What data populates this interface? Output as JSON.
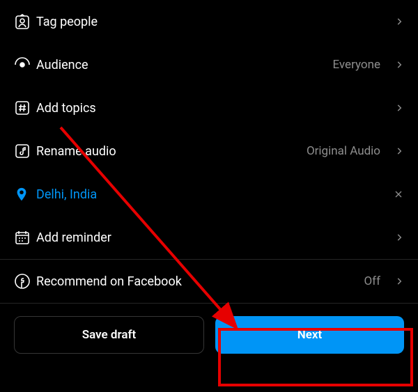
{
  "options": {
    "tag_people": {
      "label": "Tag people"
    },
    "audience": {
      "label": "Audience",
      "value": "Everyone"
    },
    "add_topics": {
      "label": "Add topics"
    },
    "rename_audio": {
      "label": "Rename audio",
      "value": "Original Audio"
    },
    "location": {
      "label": "Delhi, India"
    },
    "add_reminder": {
      "label": "Add reminder"
    },
    "recommend_facebook": {
      "label": "Recommend on Facebook",
      "value": "Off"
    }
  },
  "footer": {
    "save_draft": "Save draft",
    "next": "Next"
  }
}
